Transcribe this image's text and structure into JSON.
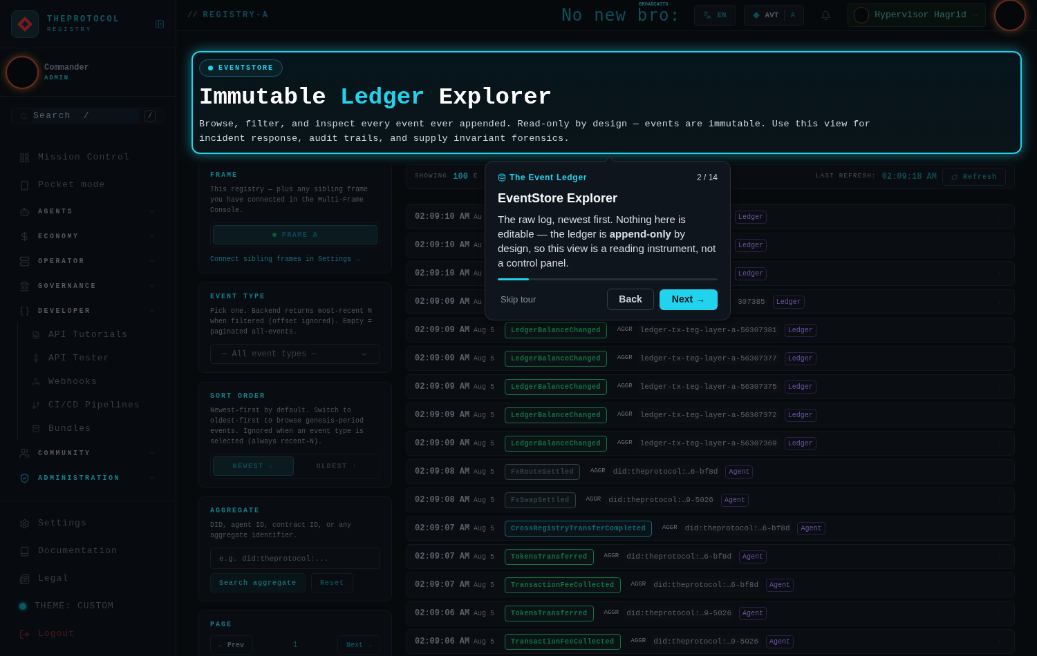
{
  "sidebar": {
    "brand": {
      "name": "THEPROTOCOL",
      "subtitle": "REGISTRY"
    },
    "profile": {
      "name": "Commander",
      "role": "ADMIN"
    },
    "search": {
      "placeholder": "Search  /",
      "shortcut": "/"
    },
    "nav": [
      {
        "kind": "link",
        "label": "Mission Control"
      },
      {
        "kind": "link",
        "label": "Pocket mode"
      },
      {
        "kind": "section",
        "label": "AGENTS",
        "expanded": false,
        "selected": false
      },
      {
        "kind": "section",
        "label": "ECONOMY",
        "expanded": false,
        "selected": false
      },
      {
        "kind": "section",
        "label": "OPERATOR",
        "expanded": false,
        "selected": false
      },
      {
        "kind": "section",
        "label": "GOVERNANCE",
        "expanded": false,
        "selected": false
      },
      {
        "kind": "section",
        "label": "DEVELOPER",
        "expanded": true,
        "selected": false,
        "children": [
          {
            "label": "API Tutorials"
          },
          {
            "label": "API Tester"
          },
          {
            "label": "Webhooks"
          },
          {
            "label": "CI/CD Pipelines"
          },
          {
            "label": "Bundles"
          }
        ]
      },
      {
        "kind": "section",
        "label": "COMMUNITY",
        "expanded": false,
        "selected": false
      },
      {
        "kind": "section",
        "label": "ADMINISTRATION",
        "expanded": true,
        "selected": true
      }
    ],
    "footer": [
      {
        "kind": "link",
        "label": "Settings"
      },
      {
        "kind": "link",
        "label": "Documentation"
      },
      {
        "kind": "link",
        "label": "Legal"
      },
      {
        "kind": "theme",
        "label": "THEME: CUSTOM"
      },
      {
        "kind": "logout",
        "label": "Logout"
      }
    ]
  },
  "topbar": {
    "prefix": "//",
    "registry": "REGISTRY-A",
    "ticker_label": "BROADCASTS",
    "ticker": "No new bro:",
    "language": "EN",
    "token": "AVT",
    "token_badge": "A",
    "user": "Hypervisor Hagrid"
  },
  "hero": {
    "badge": "EVENTSTORE",
    "title": [
      {
        "text": "Immutable",
        "accent": false
      },
      {
        "text": "Ledger",
        "accent": true
      },
      {
        "text": "Explorer",
        "accent": false
      }
    ],
    "description": "Browse, filter, and inspect every event ever appended. Read-only by design — events are immutable. Use this view for incident response, audit trails, and supply invariant forensics."
  },
  "filters": {
    "frame": {
      "label": "FRAME",
      "description": "This registry — plus any sibling frame you have connected in the Multi-Frame Console.",
      "button": "FRAME A",
      "link": "Connect sibling frames in Settings →"
    },
    "event_type": {
      "label": "EVENT TYPE",
      "description": "Pick one. Backend returns most-recent N when filtered (offset ignored). Empty = paginated all-events.",
      "select": "— All event types —"
    },
    "sort": {
      "label": "SORT ORDER",
      "description": "Newest-first by default. Switch to oldest-first to browse genesis-period events. Ignored when an event type is selected (always recent-N).",
      "options": [
        {
          "label": "NEWEST ↓",
          "selected": true
        },
        {
          "label": "OLDEST ↑",
          "selected": false
        }
      ]
    },
    "aggregate": {
      "label": "AGGREGATE",
      "description": "DID, agent ID, contract ID, or any aggregate identifier.",
      "placeholder": "e.g. did:theprotocol:...",
      "search_button": {
        "label": "Search aggregate",
        "disabled": true
      },
      "reset_button": "Reset"
    },
    "page": {
      "label": "PAGE",
      "prev": "← Prev",
      "number": "1",
      "next": "Next →"
    }
  },
  "events": {
    "showing_label": "SHOWING",
    "count": "100",
    "count_suffix": "E",
    "refresh_label": "LAST REFRESH:",
    "refresh_time": "02:09:18 AM",
    "refresh_button": "Refresh",
    "rows": [
      {
        "kind": "covered",
        "time": "02:09:10 AM",
        "date": "Au",
        "tag": "Ledger"
      },
      {
        "kind": "covered",
        "time": "02:09:10 AM",
        "date": "Au",
        "tag": "Ledger"
      },
      {
        "kind": "covered",
        "time": "02:09:10 AM",
        "date": "Au",
        "tag": "Ledger"
      },
      {
        "kind": "covered",
        "time": "02:09:09 AM",
        "date": "Au",
        "aggregate": "307385",
        "tag": "Ledger"
      },
      {
        "kind": "full",
        "time": "02:09:09 AM",
        "date": "Aug 5",
        "event": "LedgerBalanceChanged",
        "color": "#12753f",
        "aggr": "AGGR",
        "aggregate": "ledger-tx-teg-layer-a-56307381",
        "tag": "Ledger"
      },
      {
        "kind": "full",
        "time": "02:09:09 AM",
        "date": "Aug 5",
        "event": "LedgerBalanceChanged",
        "color": "#12753f",
        "aggr": "AGGR",
        "aggregate": "ledger-tx-teg-layer-a-56307377",
        "tag": "Ledger"
      },
      {
        "kind": "full",
        "time": "02:09:09 AM",
        "date": "Aug 5",
        "event": "LedgerBalanceChanged",
        "color": "#12753f",
        "aggr": "AGGR",
        "aggregate": "ledger-tx-teg-layer-a-56307375",
        "tag": "Ledger"
      },
      {
        "kind": "full",
        "time": "02:09:09 AM",
        "date": "Aug 5",
        "event": "LedgerBalanceChanged",
        "color": "#12753f",
        "aggr": "AGGR",
        "aggregate": "ledger-tx-teg-layer-a-56307372",
        "tag": "Ledger"
      },
      {
        "kind": "full",
        "time": "02:09:09 AM",
        "date": "Aug 5",
        "event": "LedgerBalanceChanged",
        "color": "#12753f",
        "aggr": "AGGR",
        "aggregate": "ledger-tx-teg-layer-a-56307369",
        "tag": "Ledger"
      },
      {
        "kind": "full",
        "time": "02:09:08 AM",
        "date": "Aug 5",
        "event": "FxRouteSettled",
        "color": "#363e47",
        "aggr": "AGGR",
        "aggregate": "did:theprotocol:…6-bf8d",
        "tag": "Agent"
      },
      {
        "kind": "full",
        "time": "02:09:08 AM",
        "date": "Aug 5",
        "event": "FxSwapSettled",
        "color": "#363e47",
        "aggr": "AGGR",
        "aggregate": "did:theprotocol:…9-5026",
        "tag": "Agent"
      },
      {
        "kind": "full",
        "time": "02:09:07 AM",
        "date": "Aug 5",
        "event": "CrossRegistryTransferCompleted",
        "color": "#0e6a80",
        "aggr": "AGGR",
        "aggregate": "did:theprotocol:…6-bf8d",
        "tag": "Agent"
      },
      {
        "kind": "full",
        "time": "02:09:07 AM",
        "date": "Aug 5",
        "event": "TokensTransferred",
        "color": "#12753f",
        "aggr": "AGGR",
        "aggregate": "did:theprotocol:…6-bf8d",
        "tag": "Agent"
      },
      {
        "kind": "full",
        "time": "02:09:07 AM",
        "date": "Aug 5",
        "event": "TransactionFeeCollected",
        "color": "#12753f",
        "aggr": "AGGR",
        "aggregate": "did:theprotocol:…6-bf8d",
        "tag": "Agent"
      },
      {
        "kind": "full",
        "time": "02:09:06 AM",
        "date": "Aug 5",
        "event": "TokensTransferred",
        "color": "#12753f",
        "aggr": "AGGR",
        "aggregate": "did:theprotocol:…9-5026",
        "tag": "Agent"
      },
      {
        "kind": "full",
        "time": "02:09:06 AM",
        "date": "Aug 5",
        "event": "TransactionFeeCollected",
        "color": "#12753f",
        "aggr": "AGGR",
        "aggregate": "did:theprotocol:…9-5026",
        "tag": "Agent"
      }
    ]
  },
  "tour": {
    "eyebrow": "The Event Ledger",
    "step": "2 / 14",
    "title": "EventStore Explorer",
    "body": "The raw log, newest first. Nothing here is editable — the ledger is **append-only** by design, so this view is a reading instrument, not a control panel.",
    "level": 0.14,
    "skip": "Skip tour",
    "back": "Back",
    "next": "Next →"
  }
}
